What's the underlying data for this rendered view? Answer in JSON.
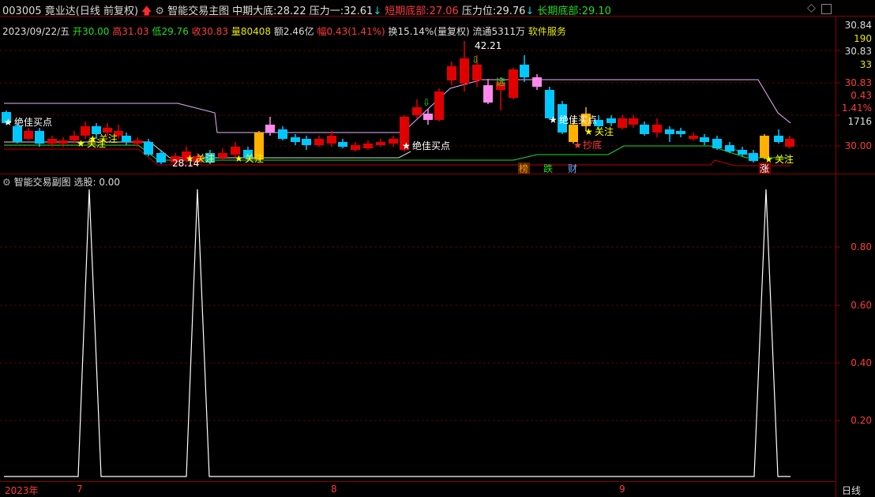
{
  "title_bar": {
    "stock": "003005 竟业达(日线 前复权)",
    "indicator": "智能交易主图",
    "mid_bottom_label": "中期大底:",
    "mid_bottom_value": "28.22",
    "pressure1_label": "压力一:",
    "pressure1_value": "32.61",
    "short_bottom_label": "短期底部:",
    "short_bottom_value": "27.06",
    "pressure_label": "压力位:",
    "pressure_value": "29.76",
    "long_bottom_label": "长期底部:",
    "long_bottom_value": "29.10",
    "colors": {
      "red": "#ff3b3b",
      "green": "#22dd22",
      "cyan": "#00e0e0",
      "yellow": "#e8e800",
      "white": "#e0e0e0"
    }
  },
  "info_bar": {
    "date": "2023/09/22/五",
    "open_label": "开",
    "open_value": "30.00",
    "high_label": "高",
    "high_value": "31.03",
    "low_label": "低",
    "low_value": "29.76",
    "close_label": "收",
    "close_value": "30.83",
    "vol_label": "量",
    "vol_value": "80408",
    "amt_label": "额",
    "amt_value": "2.46亿",
    "chg_label": "幅",
    "chg_value": "0.43(1.41%)",
    "turnover": "换15.14%(量复权)",
    "float": "流通5311万",
    "sector": "软件服务"
  },
  "right_axis_main": [
    "30.84",
    "190",
    "30.83",
    "33",
    "30.83",
    "0.43",
    "1.41%",
    "1716",
    "30.00"
  ],
  "right_axis_sub": [
    "0.80",
    "0.60",
    "0.40",
    "0.20"
  ],
  "annotations": {
    "peak_price": "42.21",
    "low_price": "28.14",
    "best_buy": "绝佳买点",
    "watch": "关注",
    "select": "选",
    "bottom_fish": "抄底",
    "bang": "榜",
    "die": "跌",
    "cai": "财",
    "zhang": "涨"
  },
  "sub_chart": {
    "title": "智能交易副图",
    "select_label": "选股:",
    "select_value": "0.00"
  },
  "x_axis": {
    "year": "2023年",
    "labels": [
      "7",
      "8",
      "9"
    ],
    "period": "日线"
  }
}
